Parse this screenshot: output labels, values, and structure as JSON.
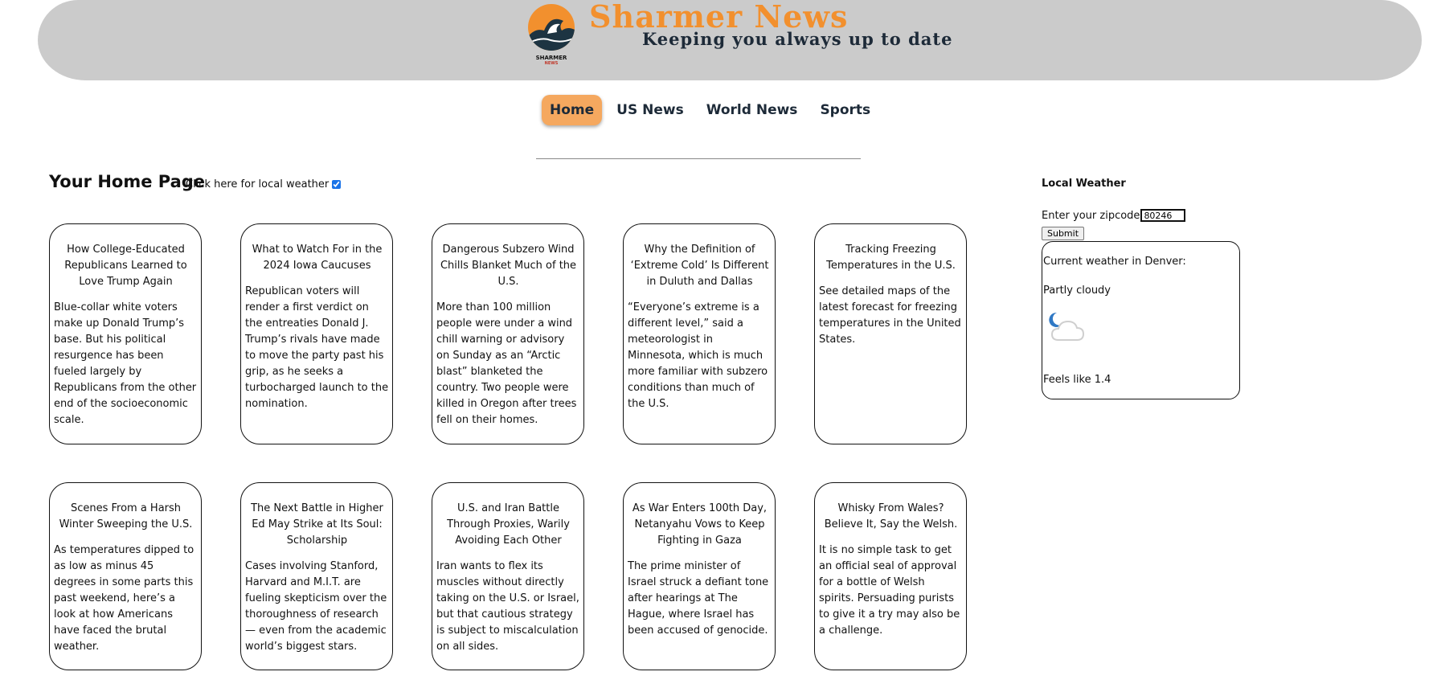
{
  "header": {
    "brand_title": "Sharmer News",
    "tagline": "Keeping you always up to date",
    "logo_text": "SHARMER",
    "logo_subtext": "NEWS",
    "brand_color": "#f2902e",
    "bg_color": "#cbcbcb"
  },
  "nav": {
    "items": [
      {
        "label": "Home",
        "active": true
      },
      {
        "label": "US News",
        "active": false
      },
      {
        "label": "World News",
        "active": false
      },
      {
        "label": "Sports",
        "active": false
      }
    ],
    "active_color": "#f5a85f"
  },
  "home": {
    "title": "Your Home Page",
    "weather_toggle_label": "Click here for local weather",
    "weather_toggle_checked": true
  },
  "articles": [
    {
      "title": "How College-Educated Republicans Learned to Love Trump Again",
      "summary": "Blue-collar white voters make up Donald Trump’s base. But his political resurgence has been fueled largely by Republicans from the other end of the socioeconomic scale."
    },
    {
      "title": "What to Watch For in the 2024 Iowa Caucuses",
      "summary": "Republican voters will render a first verdict on the entreaties Donald J. Trump’s rivals have made to move the party past his grip, as he seeks a turbocharged launch to the nomination."
    },
    {
      "title": "Dangerous Subzero Wind Chills Blanket Much of the U.S.",
      "summary": "More than 100 million people were under a wind chill warning or advisory on Sunday as an “Arctic blast” blanketed the country. Two people were killed in Oregon after trees fell on their homes."
    },
    {
      "title": "Why the Definition of ‘Extreme Cold’ Is Different in Duluth and Dallas",
      "summary": "“Everyone’s extreme is a different level,” said a meteorologist in Minnesota, which is much more familiar with subzero conditions than much of the U.S."
    },
    {
      "title": "Tracking Freezing Temperatures in the U.S.",
      "summary": "See detailed maps of the latest forecast for freezing temperatures in the United States."
    },
    {
      "title": "Scenes From a Harsh Winter Sweeping the U.S.",
      "summary": "As temperatures dipped to as low as minus 45 degrees in some parts this past weekend, here’s a look at how Americans have faced the brutal weather."
    },
    {
      "title": "The Next Battle in Higher Ed May Strike at Its Soul: Scholarship",
      "summary": "Cases involving Stanford, Harvard and M.I.T. are fueling skepticism over the thoroughness of research — even from the academic world’s biggest stars."
    },
    {
      "title": "U.S. and Iran Battle Through Proxies, Warily Avoiding Each Other",
      "summary": "Iran wants to flex its muscles without directly taking on the U.S. or Israel, but that cautious strategy is subject to miscalculation on all sides."
    },
    {
      "title": "As War Enters 100th Day, Netanyahu Vows to Keep Fighting in Gaza",
      "summary": "The prime minister of Israel struck a defiant tone after hearings at The Hague, where Israel has been accused of genocide."
    },
    {
      "title": "Whisky From Wales? Believe It, Say the Welsh.",
      "summary": "It is no simple task to get an official seal of approval for a bottle of Welsh spirits. Persuading purists to give it a try may also be a challenge."
    }
  ],
  "weather": {
    "title": "Local Weather",
    "zip_label": "Enter your zipcode",
    "zip_value": "80246",
    "submit_label": "Submit",
    "location_text": "Current weather in Denver:",
    "condition": "Partly cloudy",
    "icon": "moon-cloud-icon",
    "feels_like": "Feels like 1.4"
  }
}
